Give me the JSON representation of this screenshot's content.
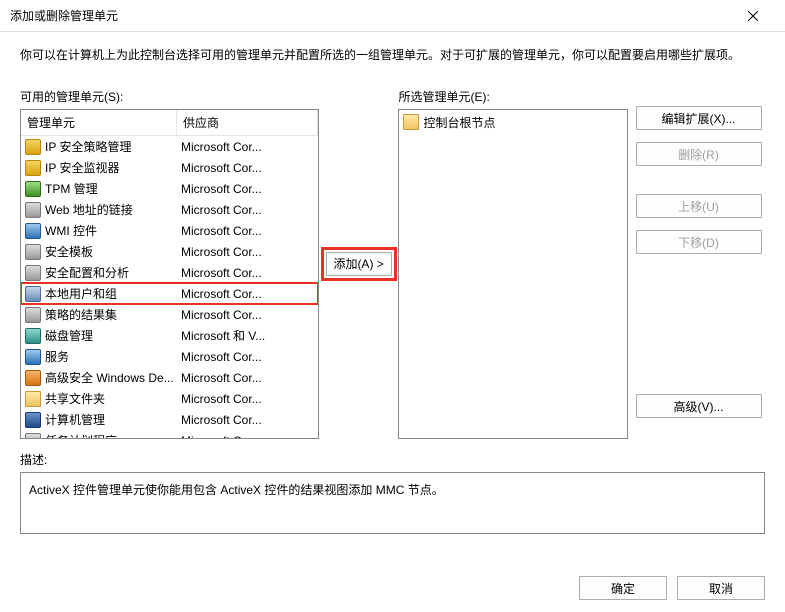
{
  "window": {
    "title": "添加或删除管理单元"
  },
  "intro": "你可以在计算机上为此控制台选择可用的管理单元并配置所选的一组管理单元。对于可扩展的管理单元，你可以配置要启用哪些扩展项。",
  "available": {
    "label": "可用的管理单元(S):",
    "columns": {
      "snapin": "管理单元",
      "vendor": "供应商"
    },
    "items": [
      {
        "name": "IP 安全策略管理",
        "vendor": "Microsoft Cor...",
        "icon": "ico-yellow"
      },
      {
        "name": "IP 安全监视器",
        "vendor": "Microsoft Cor...",
        "icon": "ico-yellow"
      },
      {
        "name": "TPM 管理",
        "vendor": "Microsoft Cor...",
        "icon": "ico-green"
      },
      {
        "name": "Web 地址的链接",
        "vendor": "Microsoft Cor...",
        "icon": "ico-gray"
      },
      {
        "name": "WMI 控件",
        "vendor": "Microsoft Cor...",
        "icon": "ico-blue"
      },
      {
        "name": "安全模板",
        "vendor": "Microsoft Cor...",
        "icon": "ico-gray"
      },
      {
        "name": "安全配置和分析",
        "vendor": "Microsoft Cor...",
        "icon": "ico-gray"
      },
      {
        "name": "本地用户和组",
        "vendor": "Microsoft Cor...",
        "icon": "ico-users",
        "highlighted": true
      },
      {
        "name": "策略的结果集",
        "vendor": "Microsoft Cor...",
        "icon": "ico-gray"
      },
      {
        "name": "磁盘管理",
        "vendor": "Microsoft 和 V...",
        "icon": "ico-teal"
      },
      {
        "name": "服务",
        "vendor": "Microsoft Cor...",
        "icon": "ico-blue"
      },
      {
        "name": "高级安全 Windows De...",
        "vendor": "Microsoft Cor...",
        "icon": "ico-orange"
      },
      {
        "name": "共享文件夹",
        "vendor": "Microsoft Cor...",
        "icon": "ico-folder"
      },
      {
        "name": "计算机管理",
        "vendor": "Microsoft Cor...",
        "icon": "ico-darkblue"
      },
      {
        "name": "任务计划程序",
        "vendor": "Microsoft Cor...",
        "icon": "ico-gray"
      }
    ]
  },
  "selected": {
    "label": "所选管理单元(E):",
    "root": "控制台根节点"
  },
  "buttons": {
    "add": "添加(A) >",
    "edit_ext": "编辑扩展(X)...",
    "remove": "删除(R)",
    "move_up": "上移(U)",
    "move_down": "下移(D)",
    "advanced": "高级(V)...",
    "ok": "确定",
    "cancel": "取消"
  },
  "description": {
    "label": "描述:",
    "text": "ActiveX 控件管理单元使你能用包含 ActiveX 控件的结果视图添加 MMC 节点。"
  }
}
